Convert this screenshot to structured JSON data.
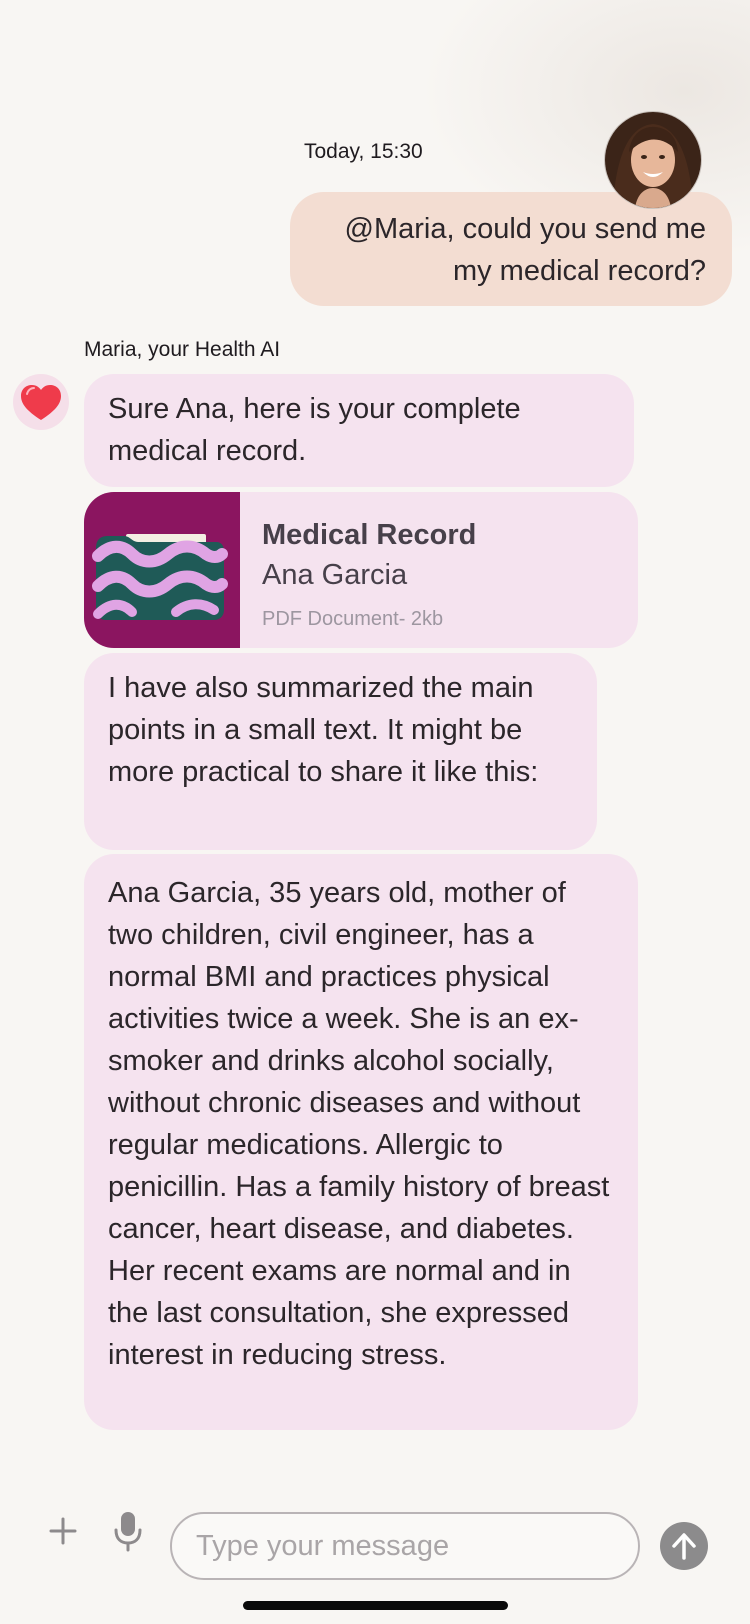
{
  "conversation": {
    "timestamp": "Today, 15:30",
    "user_message": {
      "line1": "@Maria, could you send me",
      "line2": "my medical record?"
    },
    "ai_name": "Maria, your Health AI",
    "ai_messages": {
      "greeting": "Sure Ana, here is your complete medical record.",
      "intro": "I have also summarized the main points in a small text. It might be more practical to share it like this:",
      "summary": "Ana Garcia, 35 years old, mother of two children, civil engineer, has a normal BMI and practices physical activities twice a week. She is an ex-smoker and drinks alcohol socially, without chronic diseases and without regular medications. Allergic to penicillin. Has a family history of breast cancer, heart disease, and diabetes. Her recent exams are normal and in the last consultation, she expressed interest in reducing stress."
    },
    "attachment": {
      "title": "Medical Record",
      "owner": "Ana Garcia",
      "meta": "PDF Document- 2kb",
      "icon": "folder-icon"
    }
  },
  "composer": {
    "placeholder": "Type your message",
    "value": "",
    "icons": {
      "add": "plus-icon",
      "voice": "microphone-icon",
      "send": "send-arrow-icon",
      "ai": "heart-icon"
    }
  },
  "colors": {
    "background": "#f8f6f3",
    "user_bubble": "#f3ddd2",
    "ai_bubble": "#f5e3ef",
    "attachment_thumb": "#8b1560",
    "heart": "#ef3b4b",
    "send_button": "#8c8b8c"
  }
}
